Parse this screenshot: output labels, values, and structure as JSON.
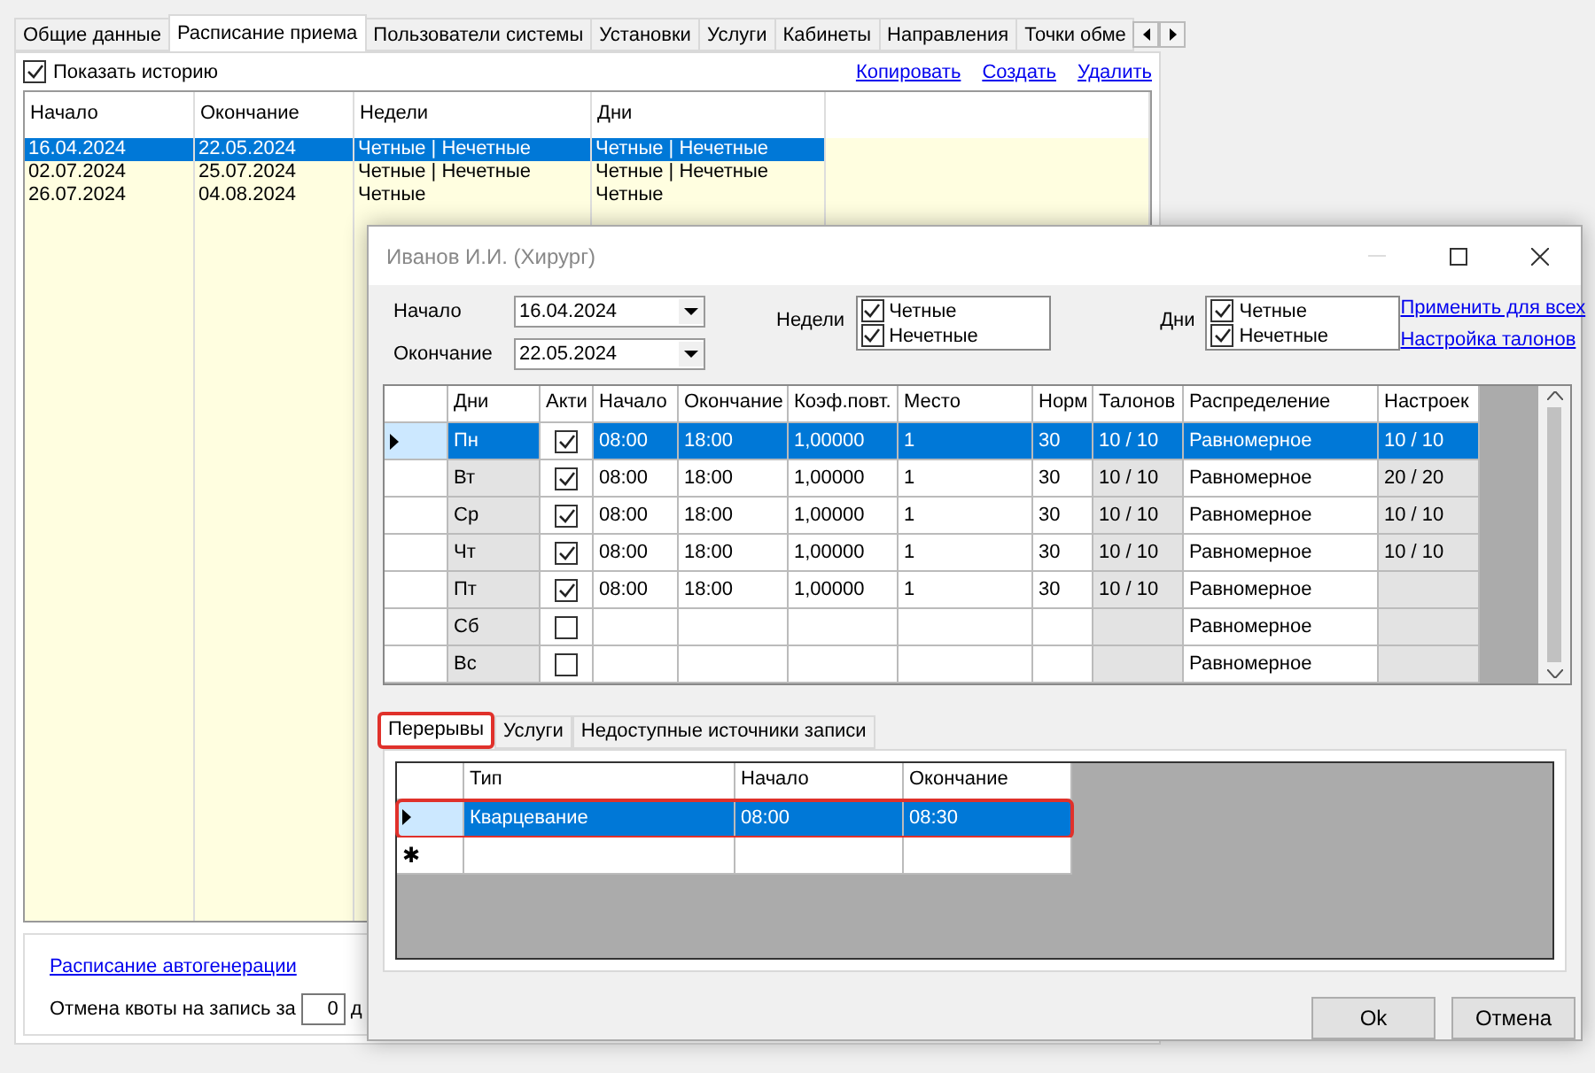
{
  "main_window": {
    "tabs": [
      {
        "label": "Общие данные",
        "selected": false
      },
      {
        "label": "Расписание приема",
        "selected": true
      },
      {
        "label": "Пользователи системы",
        "selected": false
      },
      {
        "label": "Установки",
        "selected": false
      },
      {
        "label": "Услуги",
        "selected": false
      },
      {
        "label": "Кабинеты",
        "selected": false
      },
      {
        "label": "Направления",
        "selected": false
      },
      {
        "label": "Точки обме",
        "selected": false
      }
    ],
    "show_history": {
      "label": "Показать историю",
      "checked": true
    },
    "links": [
      "Копировать",
      "Создать",
      "Удалить"
    ],
    "history_table": {
      "columns": [
        "Начало",
        "Окончание",
        "Недели",
        "Дни"
      ],
      "rows": [
        {
          "selected": true,
          "values": [
            "16.04.2024",
            "22.05.2024",
            "Четные | Нечетные",
            "Четные | Нечетные"
          ]
        },
        {
          "selected": false,
          "values": [
            "02.07.2024",
            "25.07.2024",
            "Четные | Нечетные",
            "Четные | Нечетные"
          ]
        },
        {
          "selected": false,
          "values": [
            "26.07.2024",
            "04.08.2024",
            "Четные",
            "Четные"
          ]
        }
      ]
    },
    "autogen_link": "Расписание автогенерации",
    "quota": {
      "label": "Отмена квоты на запись за",
      "value": "0",
      "unit": "д"
    }
  },
  "dialog": {
    "title": "Иванов И.И. (Хирург)",
    "start": {
      "label": "Начало",
      "value": "16.04.2024"
    },
    "end": {
      "label": "Окончание",
      "value": "22.05.2024"
    },
    "weeks": {
      "label": "Недели",
      "options": [
        {
          "label": "Четные",
          "checked": true
        },
        {
          "label": "Нечетные",
          "checked": true
        }
      ]
    },
    "days": {
      "label": "Дни",
      "options": [
        {
          "label": "Четные",
          "checked": true
        },
        {
          "label": "Нечетные",
          "checked": true
        }
      ]
    },
    "links": [
      "Применить для всех",
      "Настройка талонов"
    ],
    "schedule_table": {
      "columns": [
        {
          "label": "Дни",
          "readonly": true
        },
        {
          "label": "Акти",
          "readonly": false
        },
        {
          "label": "Начало",
          "readonly": false
        },
        {
          "label": "Окончание",
          "readonly": false
        },
        {
          "label": "Коэф.повт.",
          "readonly": false
        },
        {
          "label": "Место",
          "readonly": false
        },
        {
          "label": "Норм",
          "readonly": false
        },
        {
          "label": "Талонов",
          "readonly": true
        },
        {
          "label": "Распределение",
          "readonly": false
        },
        {
          "label": "Настроек",
          "readonly": true
        }
      ],
      "rows": [
        {
          "selected": true,
          "day": "Пн",
          "active": true,
          "start": "08:00",
          "end": "18:00",
          "coef": "1,00000",
          "place": "1",
          "norm": "30",
          "talons": "10 / 10",
          "distribution": "Равномерное",
          "settings": "10 / 10"
        },
        {
          "selected": false,
          "day": "Вт",
          "active": true,
          "start": "08:00",
          "end": "18:00",
          "coef": "1,00000",
          "place": "1",
          "norm": "30",
          "talons": "10 / 10",
          "distribution": "Равномерное",
          "settings": "20 / 20"
        },
        {
          "selected": false,
          "day": "Ср",
          "active": true,
          "start": "08:00",
          "end": "18:00",
          "coef": "1,00000",
          "place": "1",
          "norm": "30",
          "talons": "10 / 10",
          "distribution": "Равномерное",
          "settings": "10 / 10"
        },
        {
          "selected": false,
          "day": "Чт",
          "active": true,
          "start": "08:00",
          "end": "18:00",
          "coef": "1,00000",
          "place": "1",
          "norm": "30",
          "talons": "10 / 10",
          "distribution": "Равномерное",
          "settings": "10 / 10"
        },
        {
          "selected": false,
          "day": "Пт",
          "active": true,
          "start": "08:00",
          "end": "18:00",
          "coef": "1,00000",
          "place": "1",
          "norm": "30",
          "talons": "10 / 10",
          "distribution": "Равномерное"
        },
        {
          "selected": false,
          "day": "Сб",
          "active": false,
          "distribution": "Равномерное"
        },
        {
          "selected": false,
          "day": "Вс",
          "active": false,
          "distribution": "Равномерное"
        }
      ]
    },
    "sub_tabs": [
      {
        "label": "Перерывы",
        "selected": true,
        "highlighted": true
      },
      {
        "label": "Услуги",
        "selected": false,
        "highlighted": false
      },
      {
        "label": "Недоступные источники записи",
        "selected": false,
        "highlighted": false
      }
    ],
    "breaks_table": {
      "columns": [
        "Тип",
        "Начало",
        "Окончание"
      ],
      "rows": [
        {
          "selected": true,
          "highlighted": true,
          "values": [
            "Кварцевание",
            "08:00",
            "08:30"
          ]
        }
      ],
      "new_row_marker": "✱"
    },
    "buttons": [
      "Ok",
      "Отмена"
    ]
  }
}
